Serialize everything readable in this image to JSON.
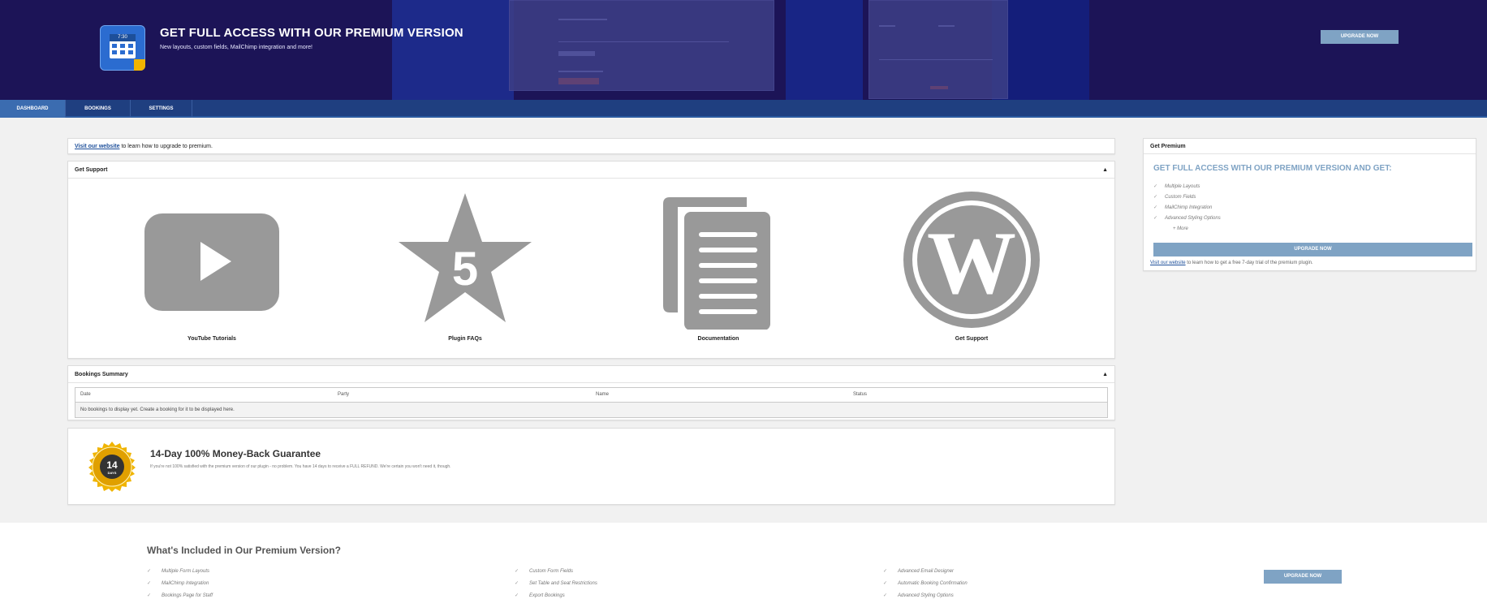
{
  "banner": {
    "title": "GET FULL ACCESS WITH OUR PREMIUM VERSION",
    "subtitle": "New layouts, custom fields, MailChimp integration and more!",
    "upgrade_label": "UPGRADE NOW",
    "logo_time": "7:30"
  },
  "nav": {
    "tabs": [
      {
        "label": "DASHBOARD"
      },
      {
        "label": "BOOKINGS"
      },
      {
        "label": "SETTINGS"
      }
    ]
  },
  "notice": {
    "link": "Visit our website",
    "text": " to learn how to upgrade to premium."
  },
  "support": {
    "title": "Get Support",
    "items": [
      {
        "label": "YouTube Tutorials",
        "icon": "youtube-icon"
      },
      {
        "label": "Plugin FAQs",
        "icon": "star-five-icon",
        "badge": "5"
      },
      {
        "label": "Documentation",
        "icon": "documents-icon"
      },
      {
        "label": "Get Support",
        "icon": "wordpress-icon"
      }
    ]
  },
  "summary": {
    "title": "Bookings Summary",
    "columns": [
      "Date",
      "Party",
      "Name",
      "Status"
    ],
    "empty_text": "No bookings to display yet. Create a booking for it to be displayed here."
  },
  "guarantee": {
    "title": "14-Day 100% Money-Back Guarantee",
    "desc": "If you're not 100% satisfied with the premium version of our plugin - no problem. You have 14 days to receive a FULL REFUND. We're certain you won't need it, though.",
    "seal_number": "14",
    "seal_days": "DAYS"
  },
  "premium": {
    "header": "Get Premium",
    "heading": "GET FULL ACCESS WITH OUR PREMIUM VERSION AND GET:",
    "features": [
      "Multiple Layouts",
      "Custom Fields",
      "MailChimp Integration",
      "Advanced Styling Options"
    ],
    "more": "+ More",
    "upgrade_label": "UPGRADE NOW",
    "foot_link": "Visit our website",
    "foot_text": " to learn how to get a free 7-day trial of the premium plugin."
  },
  "bottom": {
    "title": "What's Included in Our Premium Version?",
    "col1": [
      "Multiple Form Layouts",
      "MailChimp Integration",
      "Bookings Page for Staff"
    ],
    "col2": [
      "Custom Form Fields",
      "Set Table and Seat Restrictions",
      "Export Bookings"
    ],
    "col3": [
      "Advanced Email Designer",
      "Automatic Booking Confirmation",
      "Advanced Styling Options"
    ],
    "upgrade_label": "UPGRADE NOW"
  },
  "colors": {
    "banner_bg": "#1c1457",
    "nav_bg": "#1f3f80",
    "accent": "#7fa3c4",
    "icon_gray": "#999999",
    "seal_gold": "#f0b400"
  }
}
